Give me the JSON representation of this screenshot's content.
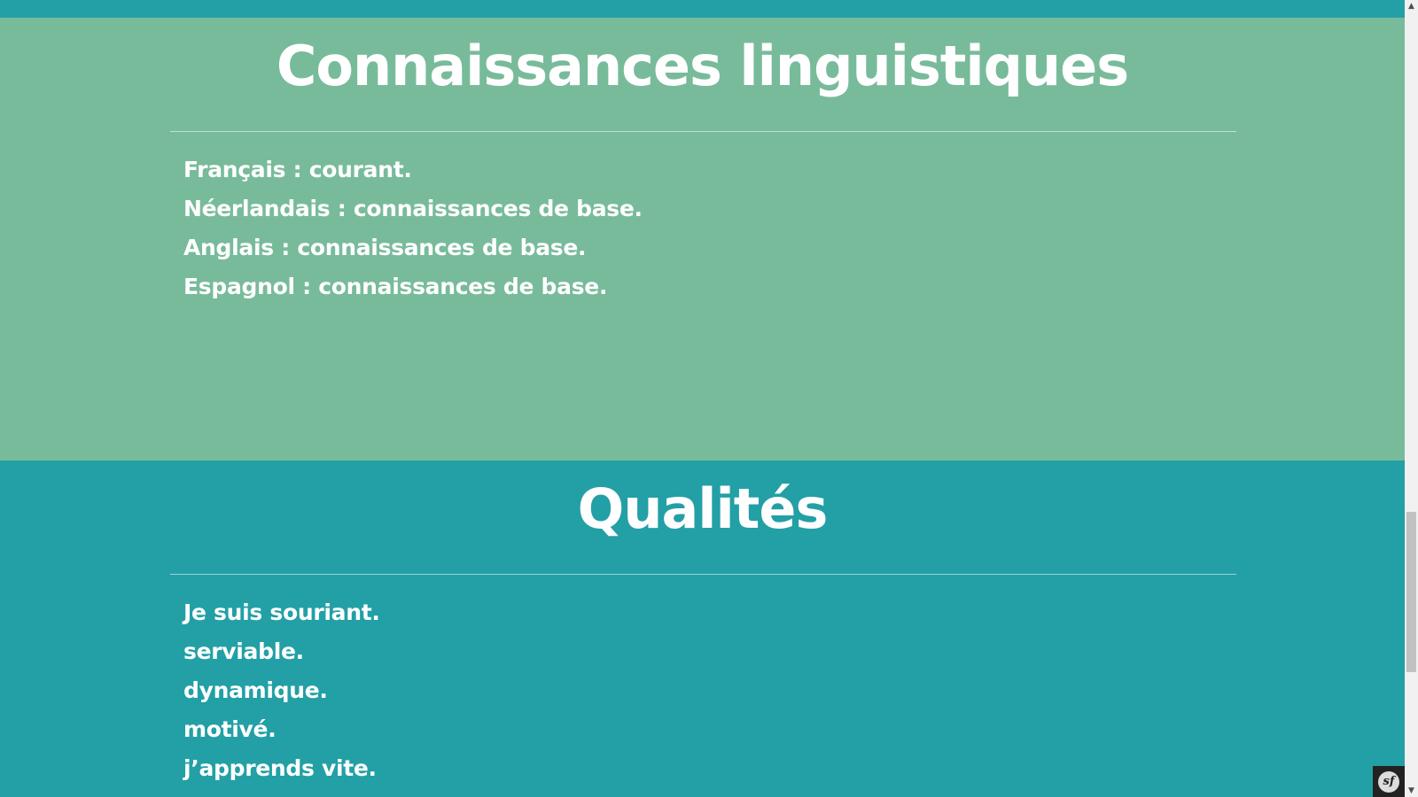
{
  "languages_section": {
    "title": "Connaissances linguistiques",
    "items": [
      "Français : courant.",
      "Néerlandais : connaissances de base.",
      "Anglais : connaissances de base.",
      "Espagnol : connaissances de base."
    ]
  },
  "qualities_section": {
    "title": "Qualités",
    "items": [
      "Je suis souriant.",
      "serviable.",
      "dynamique.",
      "motivé.",
      "j’apprends vite."
    ]
  },
  "scrollbar": {
    "up_icon": "▲",
    "down_icon": "▼"
  },
  "toolbar": {
    "logo_text": "sf"
  },
  "colors": {
    "languages_bg": "#78bb9b",
    "qualities_bg": "#22a0a6",
    "text": "#ffffff"
  }
}
